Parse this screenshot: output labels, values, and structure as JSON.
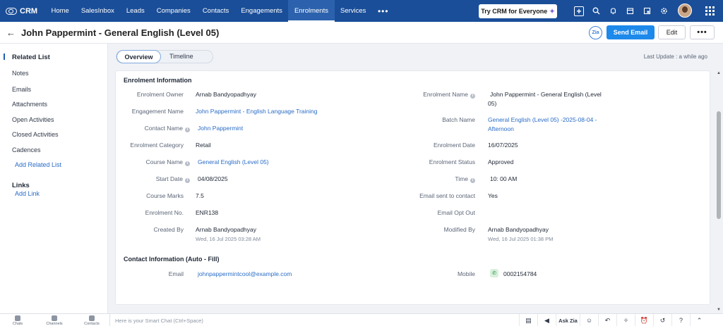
{
  "brand": {
    "name": "CRM"
  },
  "nav": {
    "items": [
      "Home",
      "SalesInbox",
      "Leads",
      "Companies",
      "Contacts",
      "Engagements",
      "Enrolments",
      "Services"
    ],
    "active_index": 6,
    "more": "•••",
    "try_button": "Try CRM for Everyone"
  },
  "record": {
    "title": "John Pappermint - General English (Level 05)",
    "send_email": "Send Email",
    "edit": "Edit",
    "more": "•••",
    "zia": "Zia"
  },
  "sidebar": {
    "heading": "Related List",
    "items": [
      "Notes",
      "Emails",
      "Attachments",
      "Open Activities",
      "Closed Activities",
      "Cadences"
    ],
    "add_related": "Add Related List",
    "links_heading": "Links",
    "add_link": "Add Link"
  },
  "tabs": {
    "overview": "Overview",
    "timeline": "Timeline",
    "last_update": "Last Update : a while ago"
  },
  "enrolment_info": {
    "title": "Enrolment Information",
    "left": [
      {
        "label": "Enrolment Owner",
        "value": "Arnab Bandyopadhyay"
      },
      {
        "label": "Engagement Name",
        "value": "John Pappermint - English Language Training"
      },
      {
        "label": "Contact Name",
        "value": "John Pappermint"
      },
      {
        "label": "Enrolment Category",
        "value": "Retail"
      },
      {
        "label": "Course Name",
        "value": "General English (Level 05)"
      },
      {
        "label": "Start Date",
        "value": "04/08/2025"
      },
      {
        "label": "Course Marks",
        "value": "7.5"
      },
      {
        "label": "Enrolment No.",
        "value": "ENR138"
      },
      {
        "label": "Created By",
        "value": "Arnab Bandyopadhyay",
        "sub": "Wed, 16 Jul 2025 03:28 AM"
      }
    ],
    "right": [
      {
        "label": "Enrolment Name",
        "value_line1": "John Pappermint - General English (Level",
        "value_line2": "05)"
      },
      {
        "label": "Batch Name",
        "value_line1": "General English (Level 05) -2025-08-04 -",
        "value_line2": "Afternoon"
      },
      {
        "label": "Enrolment Date",
        "value": "16/07/2025"
      },
      {
        "label": "Enrolment Status",
        "value": "Approved"
      },
      {
        "label": "Time",
        "value": "10: 00 AM"
      },
      {
        "label": "Email sent to contact",
        "value": "Yes"
      },
      {
        "label": "Email Opt Out",
        "value": ""
      },
      {
        "label": "Modified By",
        "value": "Arnab Bandyopadhyay",
        "sub": "Wed, 16 Jul 2025 01:38 PM"
      }
    ]
  },
  "contact_info": {
    "title": "Contact Information (Auto - Fill)",
    "email_label": "Email",
    "email_value": "johnpappermintcool@example.com",
    "mobile_label": "Mobile",
    "mobile_value": "0002154784"
  },
  "bottom": {
    "tools": [
      "Chats",
      "Channels",
      "Contacts"
    ],
    "smart_chat_placeholder": "Here is your Smart Chat (Ctrl+Space)",
    "ask_zia": "Ask Zia"
  },
  "colors": {
    "nav_bg": "#1a4e98",
    "accent": "#1d89ea",
    "link": "#2a6cc7"
  }
}
